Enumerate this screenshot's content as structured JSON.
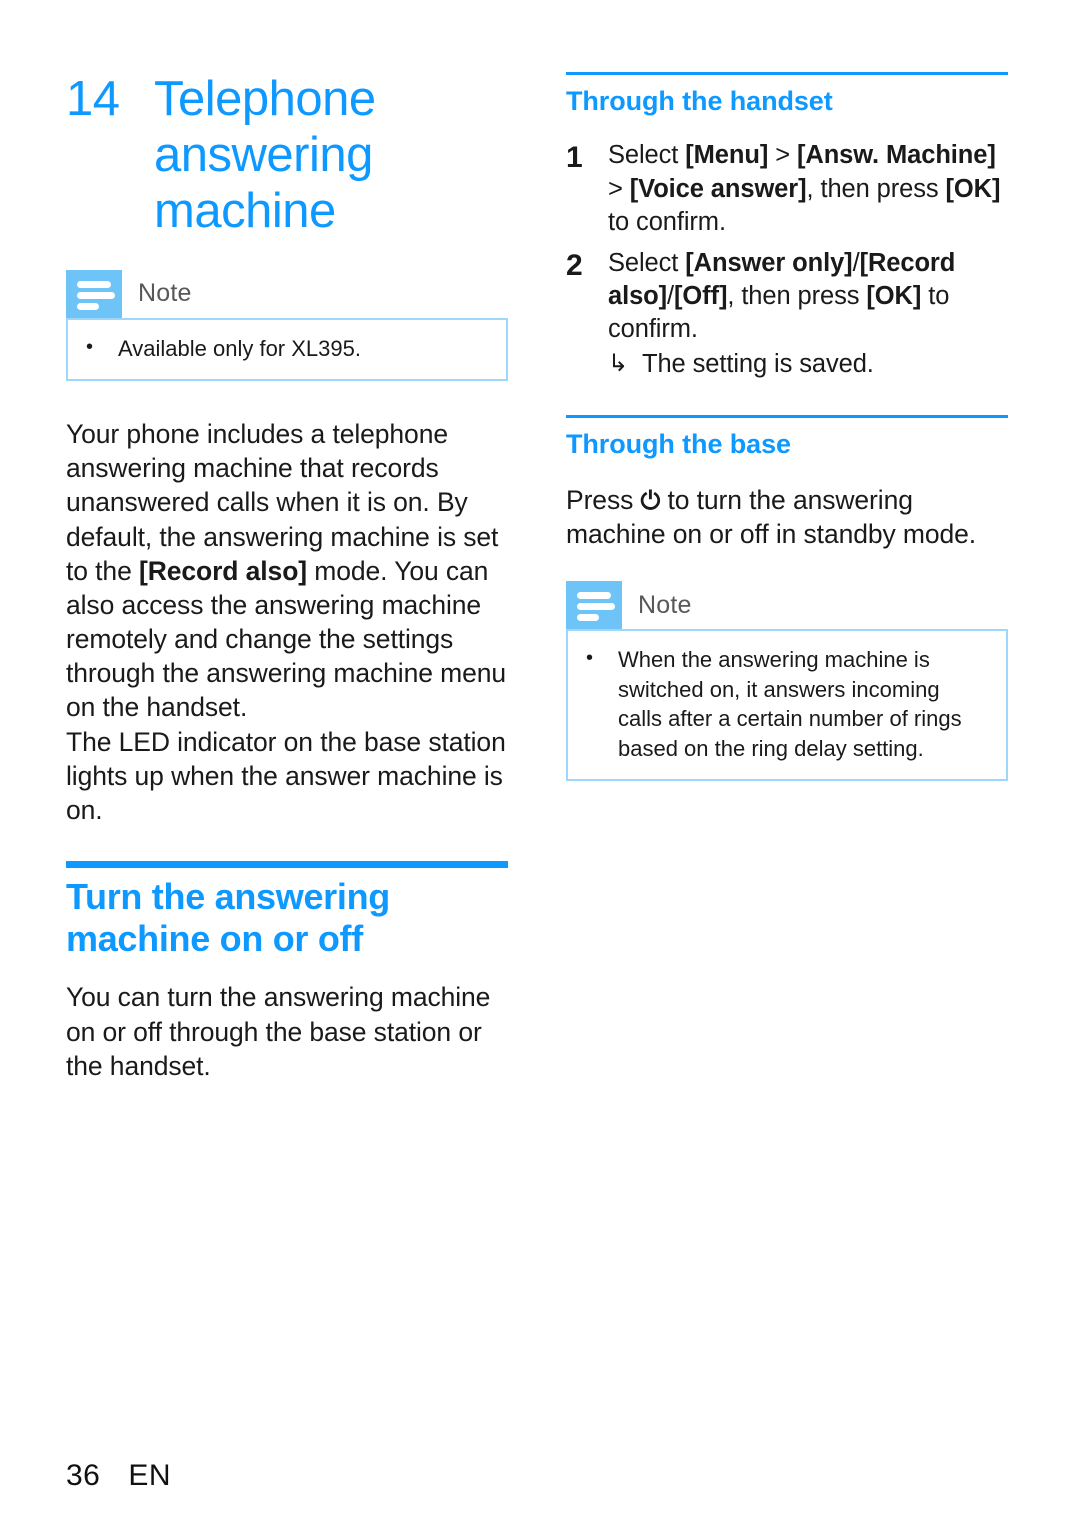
{
  "chapter": {
    "number": "14",
    "title": "Telephone answering machine"
  },
  "note_label": "Note",
  "left_column": {
    "note": {
      "label": "Note",
      "bullet": "•",
      "text": "Available only for XL395."
    },
    "paragraph_1a": "Your phone includes a telephone answering machine that records unanswered calls when it is on. By default, the answering machine is set to the ",
    "paragraph_1_bold": "[Record also]",
    "paragraph_1b": " mode. You can also access the answering machine remotely and change the settings through the answering machine menu on the handset.",
    "paragraph_2": "The LED indicator on the base station lights up when the answer machine is on.",
    "section_heading": "Turn the answering machine on or off",
    "paragraph_3": "You can turn the answering machine on or off through the base station or the handset."
  },
  "right_column": {
    "handset_heading": "Through the handset",
    "steps": [
      {
        "number": "1",
        "pre": "Select ",
        "b1": "[Menu]",
        "mid1": " > ",
        "b2": "[Answ. Machine]",
        "mid2": " > ",
        "b3": "[Voice answer]",
        "mid3": ", then press ",
        "b4": "[OK]",
        "post": " to confirm."
      },
      {
        "number": "2",
        "pre": "Select ",
        "b1": "[Answer only]",
        "mid1": "/",
        "b2": "[Record also]",
        "mid2": "/",
        "b3": "[Off]",
        "mid3": ", then press ",
        "b4": "[OK]",
        "post": " to confirm.",
        "result_arrow": "↳",
        "result_text": "The setting is saved."
      }
    ],
    "base_heading": "Through the base",
    "base_text_pre": "Press ",
    "base_power_glyph": "⏻",
    "base_text_post": " to turn the answering machine on or off in standby mode.",
    "note": {
      "label": "Note",
      "bullet": "•",
      "text": "When the answering machine is switched on, it answers incoming calls after a certain number of rings based on the ring delay setting."
    }
  },
  "footer": {
    "page_number": "36",
    "language": "EN"
  },
  "colors": {
    "accent_blue": "#0d99ff",
    "note_icon_blue": "#6ec3f7",
    "note_border_blue": "#9fd6fb",
    "note_label_gray": "#585858",
    "body_text": "#1a1a1a"
  }
}
